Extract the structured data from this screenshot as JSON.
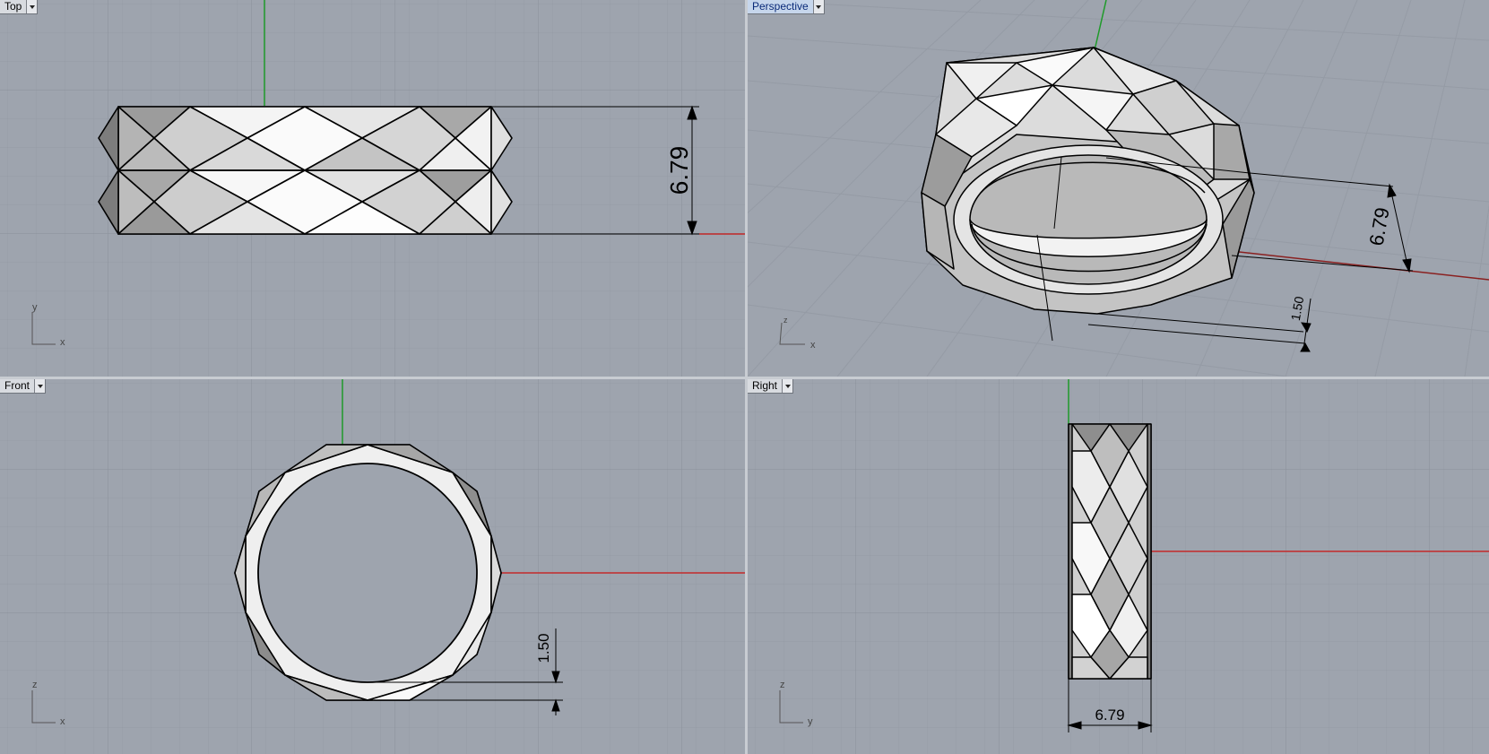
{
  "viewports": {
    "top": {
      "title": "Top",
      "axis_a": "y",
      "axis_b": "x",
      "dimension": "6.79"
    },
    "persp": {
      "title": "Perspective",
      "axis_a": "z",
      "axis_b": "x",
      "dimension": "6.79",
      "dimension2": "1.50"
    },
    "front": {
      "title": "Front",
      "axis_a": "z",
      "axis_b": "x",
      "dimension": "1.50"
    },
    "right": {
      "title": "Right",
      "axis_a": "z",
      "axis_b": "y",
      "dimension": "6.79"
    }
  },
  "colors": {
    "background": "#9ea4ae",
    "grid_minor": "#969ca6",
    "grid_major": "#8a909a",
    "x_axis": "#c42a2a",
    "y_axis": "#1f9a2a",
    "active_tab": "#c6d6ec"
  }
}
